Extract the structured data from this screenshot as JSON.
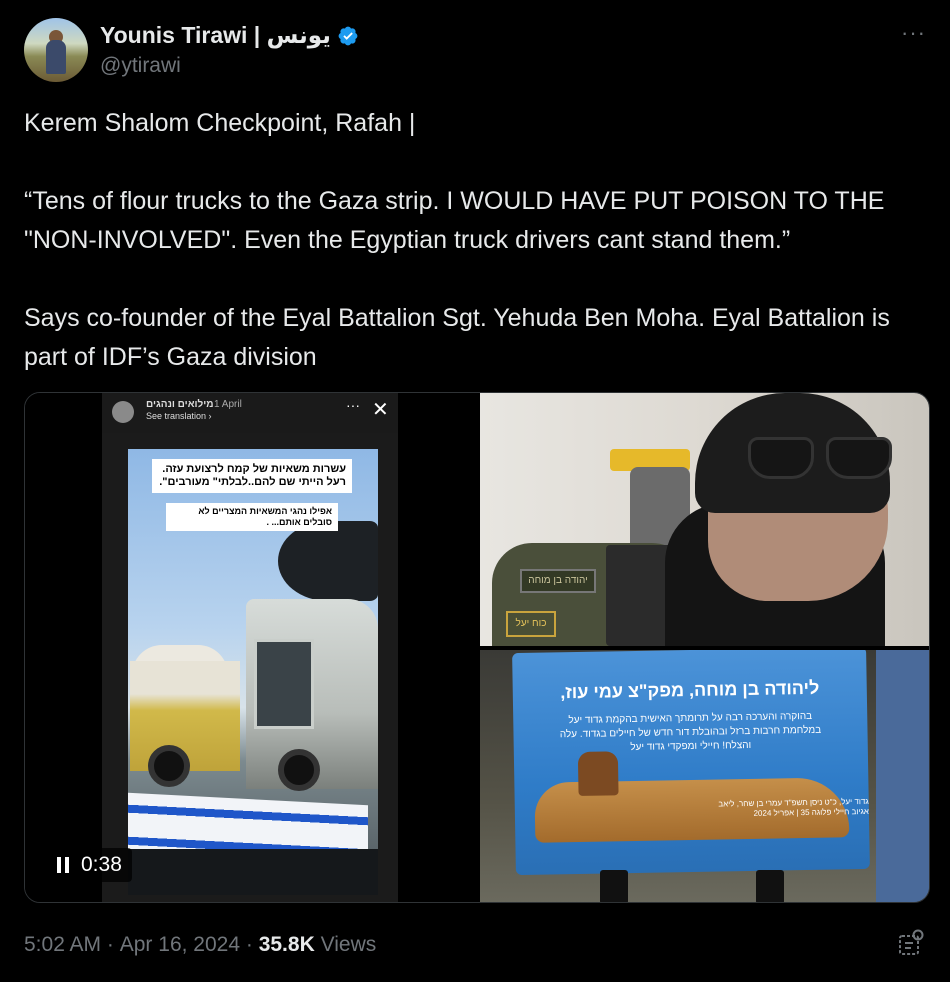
{
  "author": {
    "display_name": "Younis Tirawi | يونس",
    "handle": "@ytirawi",
    "verified": true,
    "verified_color": "#1d9bf0"
  },
  "more_label": "···",
  "tweet": {
    "line1": "Kerem Shalom Checkpoint, Rafah |",
    "line2": "“Tens of flour trucks to the Gaza strip. I WOULD HAVE PUT POISON TO THE \"NON-INVOLVED\". Even the Egyptian truck drivers cant stand them.”",
    "line3": "Says co-founder of the Eyal Battalion Sgt. Yehuda Ben Moha. Eyal Battalion is part of IDF’s Gaza division"
  },
  "video": {
    "story_user": "מילואים ונהגים",
    "story_date": "1 April",
    "see_translation": "See translation ›",
    "caption1": "עשרות משאיות של קמח לרצועת עזה. רעל הייתי שם להם..לבלתי\" מעורבים\".",
    "caption2": "אפילו נהגי המשאיות המצריים לא סובלים אותם... .",
    "duration": "0:38",
    "close_label": "✕",
    "dots_label": "···"
  },
  "photo1": {
    "patch_text": "יהודה בן מוחה",
    "patch2_text": "כוח יעל"
  },
  "photo2": {
    "plaque_title": "ליהודה בן מוחה, מפק\"צ עמי עוז,",
    "plaque_body": "בהוקרה והערכה רבה על תרומתך האישית בהקמת גדוד יעל במלחמת חרבות ברזל ובהובלת דור חדש של חיילים בגדוד. עלה והצלח! חיילי ומפקדי גדוד יעל",
    "plaque_foot": "גדוד יעל, כ\"ט ניסן תשפ\"ד עמרי בן שחר, ליאב אגיוב חיילי פלוגה 35 | אפריל 2024"
  },
  "footer": {
    "time": "5:02 AM",
    "date": "Apr 16, 2024",
    "views_count": "35.8K",
    "views_label": "Views",
    "separator": "·"
  },
  "colors": {
    "background": "#000000",
    "text": "#e7e9ea",
    "muted": "#71767b",
    "border": "#2f3336"
  }
}
